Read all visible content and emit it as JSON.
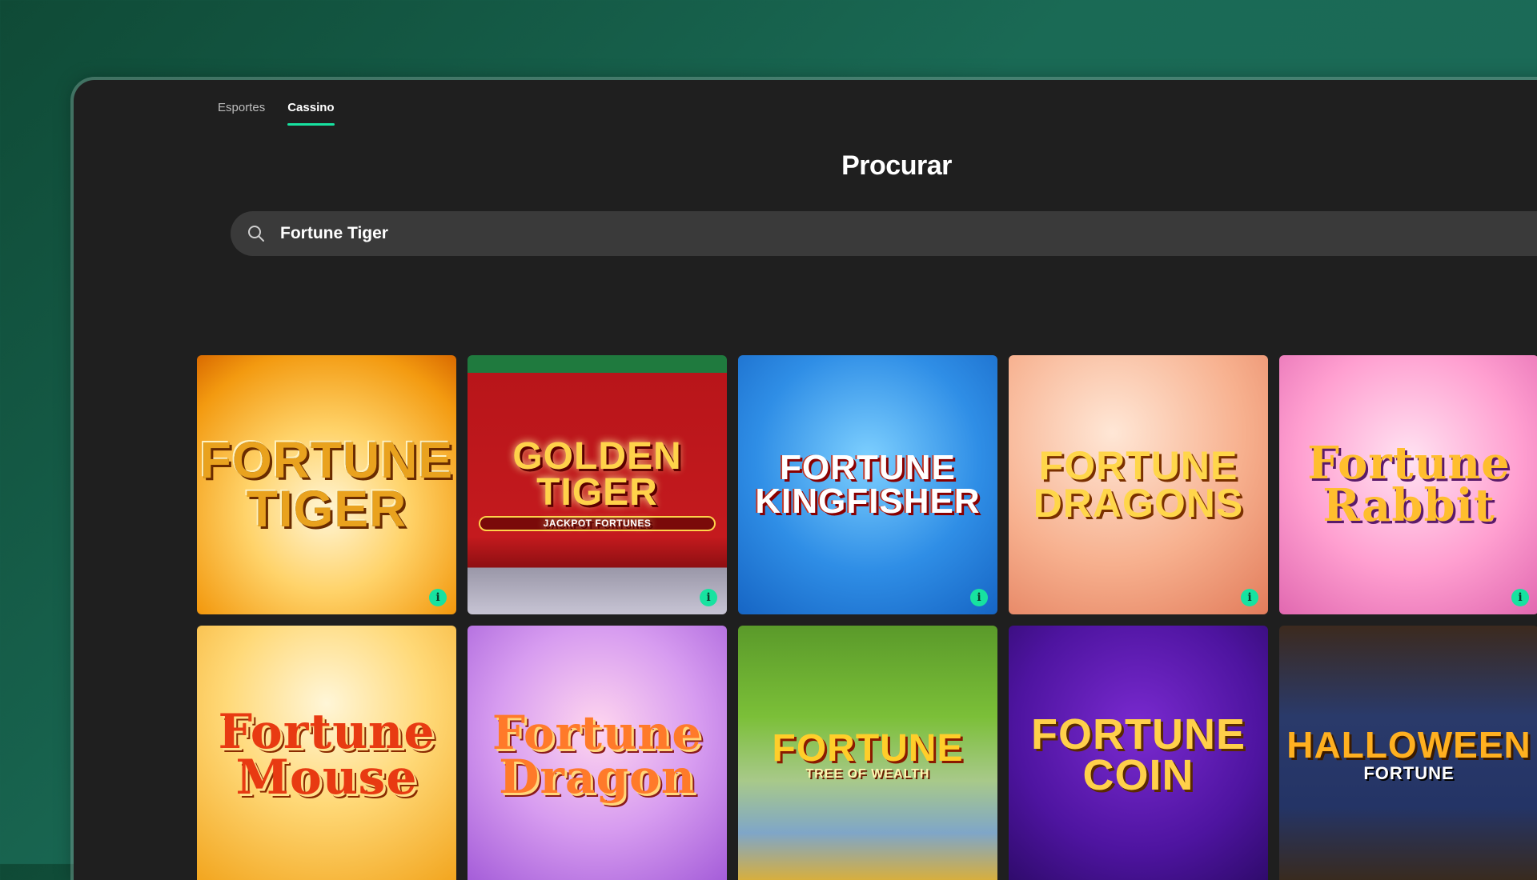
{
  "nav": {
    "tabs": [
      {
        "label": "Esportes",
        "active": false
      },
      {
        "label": "Cassino",
        "active": true
      }
    ]
  },
  "page": {
    "title": "Procurar"
  },
  "search": {
    "value": "Fortune Tiger",
    "icon": "search-icon"
  },
  "colors": {
    "accent": "#17e2a0",
    "background": "#1f1f1f",
    "search_bg": "#3a3a3a"
  },
  "results": [
    {
      "title": "Fortune Tiger"
    },
    {
      "title": "Golden Tiger",
      "subtitle": "JACKPOT FORTUNES"
    },
    {
      "title": "Fortune Kingfisher"
    },
    {
      "title": "Fortune Dragons"
    },
    {
      "title": "Fortune Rabbit"
    },
    {
      "title": "Fortune Mouse"
    },
    {
      "title": "Fortune Dragon"
    },
    {
      "title": "Fortune",
      "subtitle": "TREE OF WEALTH"
    },
    {
      "title": "Fortune Coin"
    },
    {
      "title": "Halloween",
      "subtitle": "FORTUNE"
    }
  ],
  "info_badge_label": "i"
}
